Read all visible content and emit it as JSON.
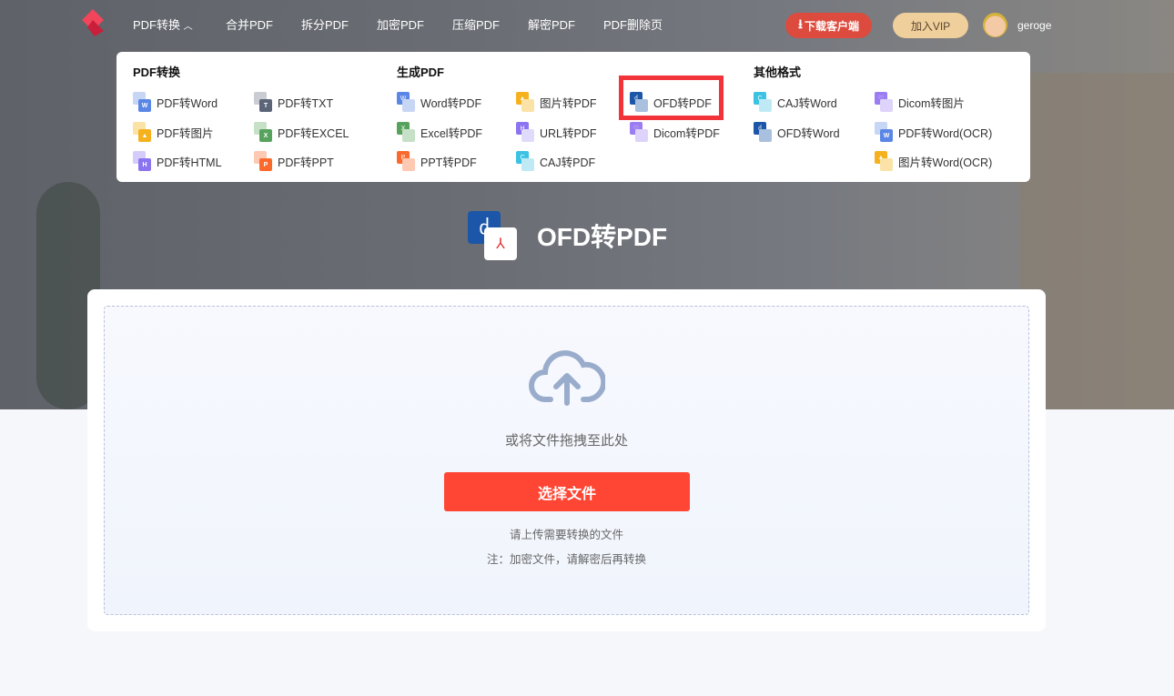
{
  "nav": {
    "items": [
      "PDF转换",
      "合并PDF",
      "拆分PDF",
      "加密PDF",
      "压缩PDF",
      "解密PDF",
      "PDF删除页"
    ],
    "download": "下载客户端",
    "vip": "加入VIP",
    "username": "geroge"
  },
  "menu": {
    "groups": [
      "PDF转换",
      "生成PDF",
      "其他格式"
    ],
    "items": [
      {
        "label": "PDF转Word",
        "icon": "pdf-to-word-icon",
        "letter": "W",
        "color": "#5a86e6",
        "back": "#c8d6f6"
      },
      {
        "label": "PDF转TXT",
        "icon": "pdf-to-txt-icon",
        "letter": "T",
        "color": "#5b6577",
        "back": "#c9ccd3"
      },
      {
        "label": "PDF转图片",
        "icon": "pdf-to-image-icon",
        "letter": "▲",
        "color": "#f5b21e",
        "back": "#fbe3a8"
      },
      {
        "label": "PDF转EXCEL",
        "icon": "pdf-to-excel-icon",
        "letter": "X",
        "color": "#57a35e",
        "back": "#c6e1c8"
      },
      {
        "label": "PDF转HTML",
        "icon": "pdf-to-html-icon",
        "letter": "H",
        "color": "#8c74f0",
        "back": "#d6ccfb"
      },
      {
        "label": "PDF转PPT",
        "icon": "pdf-to-ppt-icon",
        "letter": "P",
        "color": "#fb6a2c",
        "back": "#fdc9b2"
      },
      {
        "label": "Word转PDF",
        "icon": "word-to-pdf-icon",
        "letter": "W",
        "color": "#5a86e6",
        "back": "#c8d6f6"
      },
      {
        "label": "图片转PDF",
        "icon": "image-to-pdf-icon",
        "letter": "▲",
        "color": "#f5b21e",
        "back": "#fbe3a8"
      },
      {
        "label": "OFD转PDF",
        "icon": "ofd-to-pdf-icon",
        "letter": "ძ",
        "color": "#1c56a8",
        "back": "#a9c0de"
      },
      {
        "label": "Excel转PDF",
        "icon": "excel-to-pdf-icon",
        "letter": "X",
        "color": "#57a35e",
        "back": "#c6e1c8"
      },
      {
        "label": "URL转PDF",
        "icon": "url-to-pdf-icon",
        "letter": "H",
        "color": "#8c74f0",
        "back": "#e1dbfb"
      },
      {
        "label": "Dicom转PDF",
        "icon": "dicom-to-pdf-icon",
        "letter": "♡",
        "color": "#9b7cf2",
        "back": "#ddd3fb"
      },
      {
        "label": "PPT转PDF",
        "icon": "ppt-to-pdf-icon",
        "letter": "P",
        "color": "#fb6a2c",
        "back": "#fdc9b2"
      },
      {
        "label": "CAJ转PDF",
        "icon": "caj-to-pdf-icon",
        "letter": "C",
        "color": "#3cc2e3",
        "back": "#bfeaf5"
      },
      {
        "label": "CAJ转Word",
        "icon": "caj-to-word-icon",
        "letter": "C",
        "color": "#3cc2e3",
        "back": "#bfeaf5"
      },
      {
        "label": "Dicom转图片",
        "icon": "dicom-to-image-icon",
        "letter": "♡",
        "color": "#9b7cf2",
        "back": "#ddd3fb"
      },
      {
        "label": "OFD转Word",
        "icon": "ofd-to-word-icon",
        "letter": "ძ",
        "color": "#1c56a8",
        "back": "#a9c0de"
      },
      {
        "label": "PDF转Word(OCR)",
        "icon": "pdf-to-word-ocr-icon",
        "letter": "W",
        "color": "#5a86e6",
        "back": "#c8d6f6"
      },
      {
        "label": "图片转Word(OCR)",
        "icon": "image-to-word-ocr-icon",
        "letter": "▲",
        "color": "#f5b21e",
        "back": "#fbe3a8"
      }
    ]
  },
  "page": {
    "title": "OFD转PDF",
    "drop_hint": "或将文件拖拽至此处",
    "select_button": "选择文件",
    "note1": "请上传需要转换的文件",
    "note2": "注：加密文件，请解密后再转换"
  },
  "colors": {
    "accent": "#ff4533",
    "highlight": "#f2333a"
  }
}
